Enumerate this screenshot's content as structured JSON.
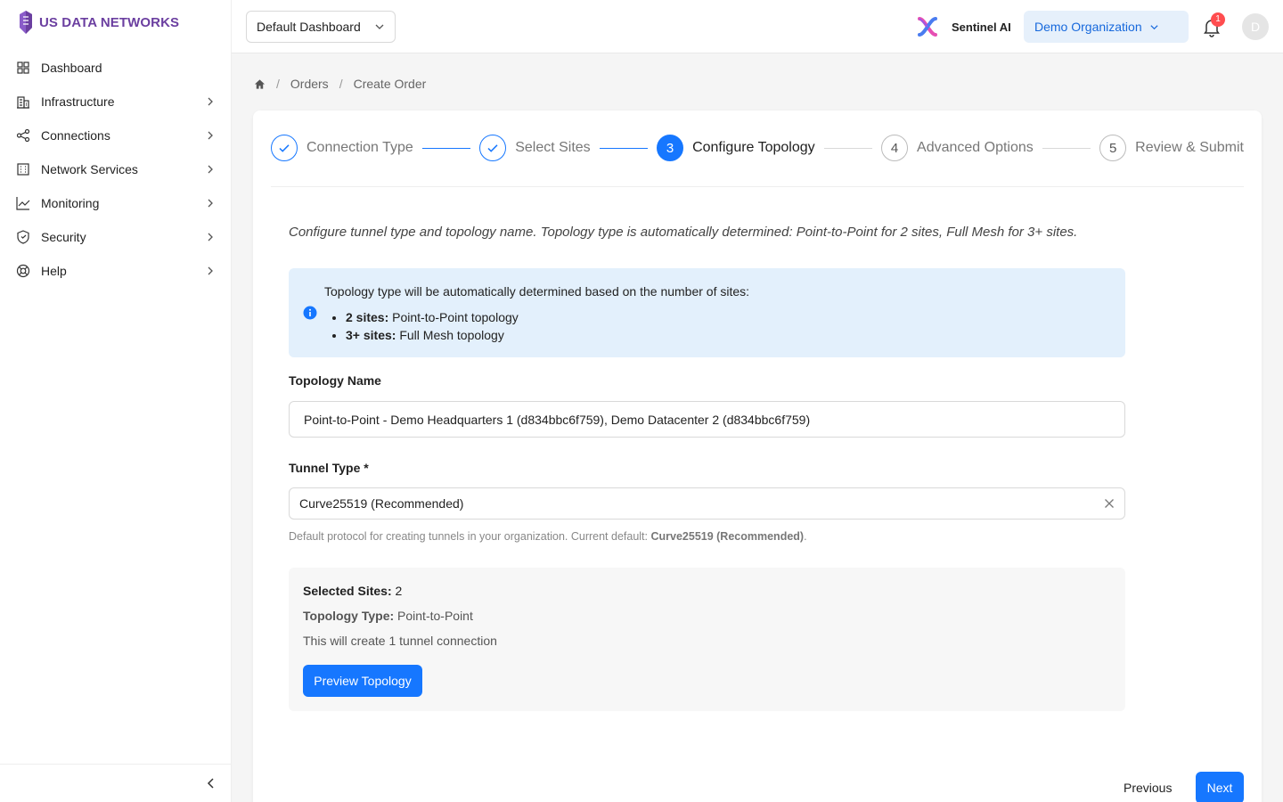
{
  "brand": {
    "name": "US DATA NETWORKS",
    "color": "#6b3fa0"
  },
  "sidebar": {
    "items": [
      {
        "label": "Dashboard",
        "icon": "grid-icon",
        "has_children": false
      },
      {
        "label": "Infrastructure",
        "icon": "building-icon",
        "has_children": true
      },
      {
        "label": "Connections",
        "icon": "share-nodes-icon",
        "has_children": true
      },
      {
        "label": "Network Services",
        "icon": "server-grid-icon",
        "has_children": true
      },
      {
        "label": "Monitoring",
        "icon": "line-chart-icon",
        "has_children": true
      },
      {
        "label": "Security",
        "icon": "shield-icon",
        "has_children": true
      },
      {
        "label": "Help",
        "icon": "lifebuoy-icon",
        "has_children": true
      }
    ],
    "collapse_icon": "chevron-left-icon"
  },
  "header": {
    "dashboard_select": "Default Dashboard",
    "ai_label": "Sentinel AI",
    "organization": "Demo Organization",
    "notification_count": "1",
    "avatar_initial": "D"
  },
  "breadcrumb": {
    "items": [
      "Orders",
      "Create Order"
    ],
    "home_icon": "home-icon"
  },
  "steps": [
    {
      "number": "1",
      "label": "Connection Type",
      "status": "done"
    },
    {
      "number": "2",
      "label": "Select Sites",
      "status": "done"
    },
    {
      "number": "3",
      "label": "Configure Topology",
      "status": "active"
    },
    {
      "number": "4",
      "label": "Advanced Options",
      "status": "pending"
    },
    {
      "number": "5",
      "label": "Review & Submit",
      "status": "pending"
    }
  ],
  "description": "Configure tunnel type and topology name. Topology type is automatically determined: Point-to-Point for 2 sites, Full Mesh for 3+ sites.",
  "info": {
    "title": "Topology type will be automatically determined based on the number of sites:",
    "items": [
      {
        "bold": "2 sites:",
        "text": " Point-to-Point topology"
      },
      {
        "bold": "3+ sites:",
        "text": " Full Mesh topology"
      }
    ]
  },
  "form": {
    "topology_name_label": "Topology Name",
    "topology_name_value": "Point-to-Point - Demo Headquarters 1 (d834bbc6f759), Demo Datacenter 2 (d834bbc6f759)",
    "tunnel_type_label": "Tunnel Type *",
    "tunnel_type_value": "Curve25519 (Recommended)",
    "hint_prefix": "Default protocol for creating tunnels in your organization. Current default: ",
    "hint_value": "Curve25519 (Recommended)",
    "hint_suffix": "."
  },
  "summary": {
    "sites_label": "Selected Sites:",
    "sites_value": " 2",
    "type_label": "Topology Type:",
    "type_value": " Point-to-Point",
    "note": "This will create 1 tunnel connection",
    "preview_button": "Preview Topology"
  },
  "footer": {
    "previous": "Previous",
    "next": "Next"
  },
  "colors": {
    "primary": "#1677ff",
    "info_bg": "#e3f0fc",
    "badge": "#ff4d4f"
  }
}
